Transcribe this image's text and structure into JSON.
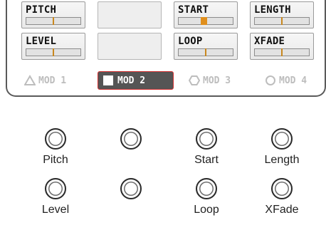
{
  "parameters": [
    {
      "label": "PITCH",
      "value": 0.5,
      "style": "line"
    },
    {
      "label": "",
      "value": null,
      "style": "blank"
    },
    {
      "label": "START",
      "value": 0.46,
      "style": "block"
    },
    {
      "label": "LENGTH",
      "value": 0.5,
      "style": "line"
    },
    {
      "label": "LEVEL",
      "value": 0.5,
      "style": "line"
    },
    {
      "label": "",
      "value": null,
      "style": "blank"
    },
    {
      "label": "LOOP",
      "value": 0.5,
      "style": "line"
    },
    {
      "label": "XFADE",
      "value": 0.5,
      "style": "line"
    }
  ],
  "mod_tabs": [
    {
      "label": "MOD 1",
      "icon": "triangle-icon",
      "active": false
    },
    {
      "label": "MOD 2",
      "icon": "square-icon",
      "active": true
    },
    {
      "label": "MOD 3",
      "icon": "hexagon-icon",
      "active": false
    },
    {
      "label": "MOD 4",
      "icon": "circle-icon",
      "active": false
    }
  ],
  "knobs": [
    {
      "label": "Pitch"
    },
    {
      "label": ""
    },
    {
      "label": "Start"
    },
    {
      "label": "Length"
    },
    {
      "label": "Level"
    },
    {
      "label": ""
    },
    {
      "label": "Loop"
    },
    {
      "label": "XFade"
    }
  ],
  "colors": {
    "accent": "#e08f1c",
    "active_tab_border": "#d22f2f",
    "active_tab_bg": "#555555"
  }
}
